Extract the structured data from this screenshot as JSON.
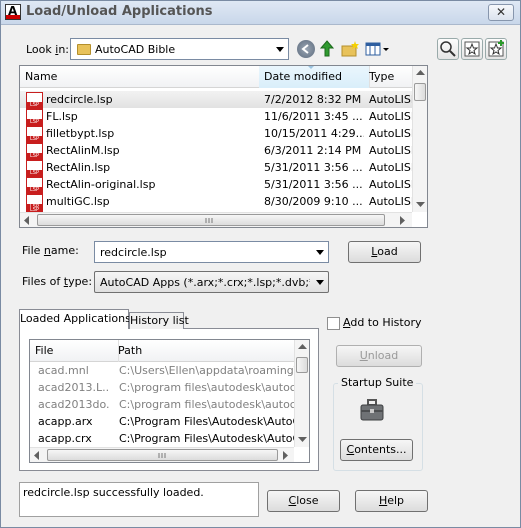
{
  "window": {
    "title": "Load/Unload Applications",
    "close_glyph": "✕"
  },
  "lookin": {
    "label_pre": "Look ",
    "label_key": "i",
    "label_post": "n:",
    "value": "AutoCAD Bible",
    "icons": [
      "back-arrow-icon",
      "up-folder-icon",
      "new-folder-icon",
      "views-menu-icon"
    ]
  },
  "right_tools": [
    "find-icon",
    "favorites-icon",
    "add-favorite-icon"
  ],
  "file_list": {
    "columns": {
      "name": "Name",
      "date": "Date modified",
      "type": "Type"
    },
    "rows": [
      {
        "name": "redcircle.lsp",
        "date": "7/2/2012 8:32 PM",
        "type": "AutoLISP"
      },
      {
        "name": "FL.lsp",
        "date": "11/6/2011 3:45 ...",
        "type": "AutoLISP"
      },
      {
        "name": "filletbypt.lsp",
        "date": "10/15/2011 4:29...",
        "type": "AutoLISP"
      },
      {
        "name": "RectAlinM.lsp",
        "date": "6/3/2011 2:14 PM",
        "type": "AutoLISP"
      },
      {
        "name": "RectAlin.lsp",
        "date": "5/31/2011 3:56 ...",
        "type": "AutoLISP"
      },
      {
        "name": "RectAlin-original.lsp",
        "date": "5/31/2011 3:56 ...",
        "type": "AutoLISP"
      },
      {
        "name": "multiGC.lsp",
        "date": "8/30/2009 9:10 ...",
        "type": "AutoLISP"
      }
    ]
  },
  "filename": {
    "label_pre": "File ",
    "label_key": "n",
    "label_post": "ame:",
    "value": "redcircle.lsp"
  },
  "filetype": {
    "label_pre": "Files of ",
    "label_key": "t",
    "label_post": "ype:",
    "value": "AutoCAD Apps (*.arx;*.crx;*.lsp;*.dvb;*.dbx;*"
  },
  "buttons": {
    "load_key": "L",
    "load_rest": "oad",
    "unload_key": "U",
    "unload_rest": "nload",
    "contents_key": "C",
    "contents_rest": "ontents...",
    "close_key": "C",
    "close_rest": "lose",
    "help_key": "H",
    "help_rest": "elp"
  },
  "tabs": {
    "loaded": "Loaded Applications",
    "history": "History list"
  },
  "loaded_apps": {
    "columns": {
      "file": "File",
      "path": "Path"
    },
    "rows": [
      {
        "file": "acad.mnl",
        "path": "C:\\Users\\Ellen\\appdata\\roaming\\a",
        "grey": true
      },
      {
        "file": "acad2013.L...",
        "path": "C:\\program files\\autodesk\\autocad",
        "grey": true
      },
      {
        "file": "acad2013do...",
        "path": "C:\\program files\\autodesk\\autocad",
        "grey": true
      },
      {
        "file": "acapp.arx",
        "path": "C:\\Program Files\\Autodesk\\AutoCA",
        "grey": false
      },
      {
        "file": "acapp.crx",
        "path": "C:\\Program Files\\Autodesk\\AutoCA",
        "grey": false
      }
    ]
  },
  "history_checkbox": {
    "label_key": "A",
    "label_rest": "dd to History",
    "checked": false
  },
  "startup_suite": {
    "title": "Startup Suite",
    "icon": "briefcase-icon"
  },
  "status_text": "redcircle.lsp successfully loaded.",
  "colors": {
    "selected_row": "#e5e5e5",
    "lsp_red": "#c81e1e",
    "folder": "#e8c25a"
  }
}
